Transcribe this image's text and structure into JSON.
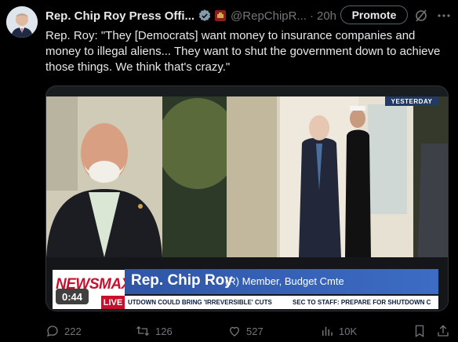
{
  "author": {
    "name": "Rep. Chip Roy Press Offi...",
    "handle": "@RepChipR...",
    "time": "20h"
  },
  "header": {
    "dot": "·",
    "promote_label": "Promote"
  },
  "tweet": {
    "text": "Rep. Roy: \"They [Democrats] want money to insurance companies and money to illegal aliens... They want to shut the government down to achieve those things. We think that's crazy.\""
  },
  "video": {
    "badge": "YESTERDAY",
    "network": "NEWSMAX",
    "live": "LIVE",
    "speaker_name": "Rep. Chip Roy",
    "speaker_role": "(R) Member, Budget Cmte",
    "ticker_left": "UTDOWN COULD BRING 'IRREVERSIBLE' CUTS",
    "ticker_right": "SEC TO STAFF: PREPARE FOR SHUTDOWN C",
    "timestamp": "0:44"
  },
  "actions": {
    "replies": "222",
    "reposts": "126",
    "likes": "527",
    "views": "10K"
  },
  "colors": {
    "background": "#000000",
    "text": "#e7e9ea",
    "muted": "#71767b",
    "verified": "#829aab",
    "newsmax_red": "#c8102e",
    "namebar_blue": "#2f56a6"
  },
  "icons": [
    "verified-badge-icon",
    "affiliate-badge-icon",
    "grok-icon",
    "more-icon",
    "reply-icon",
    "repost-icon",
    "like-icon",
    "views-icon",
    "bookmark-icon",
    "share-icon"
  ]
}
